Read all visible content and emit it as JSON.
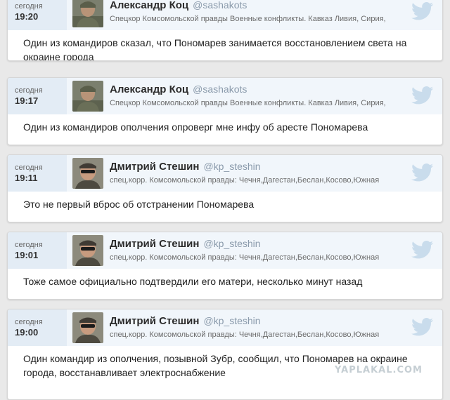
{
  "cards": [
    {
      "time_label": "сегодня",
      "time": "19:20",
      "name": "Александр Коц",
      "handle": "@sashakots",
      "bio": "Спецкор Комсомольской правды Военные конфликты. Кавказ Ливия, Сирия,",
      "text": "Один из командиров сказал, что Пономарев занимается восстановлением света на окраине города"
    },
    {
      "time_label": "сегодня",
      "time": "19:17",
      "name": "Александр Коц",
      "handle": "@sashakots",
      "bio": "Спецкор Комсомольской правды Военные конфликты. Кавказ Ливия, Сирия,",
      "text": "Один из командиров ополчения опроверг мне инфу об аресте Пономарева"
    },
    {
      "time_label": "сегодня",
      "time": "19:11",
      "name": "Дмитрий Стешин",
      "handle": "@kp_steshin",
      "bio": "спец.корр. Комсомольской правды: Чечня,Дагестан,Беслан,Косово,Южная",
      "text": "Это не первый вброс об отстранении Пономарева"
    },
    {
      "time_label": "сегодня",
      "time": "19:01",
      "name": "Дмитрий Стешин",
      "handle": "@kp_steshin",
      "bio": "спец.корр. Комсомольской правды: Чечня,Дагестан,Беслан,Косово,Южная",
      "text": "Тоже самое официально подтвердили его матери, несколько минут назад"
    },
    {
      "time_label": "сегодня",
      "time": "19:00",
      "name": "Дмитрий Стешин",
      "handle": "@kp_steshin",
      "bio": "спец.корр. Комсомольской правды: Чечня,Дагестан,Беслан,Косово,Южная",
      "text": "Один командир из ополчения, позывной Зубр, сообщил, что Пономарев на окраине города, восстанавливает электроснабжение"
    }
  ],
  "watermark": "YAPLAKAL.COM",
  "icons": {
    "service": "twitter-bird-icon"
  },
  "colors": {
    "handle": "#8a9aab",
    "bird": "#c9dcec",
    "header_bg": "#f1f6fb"
  }
}
